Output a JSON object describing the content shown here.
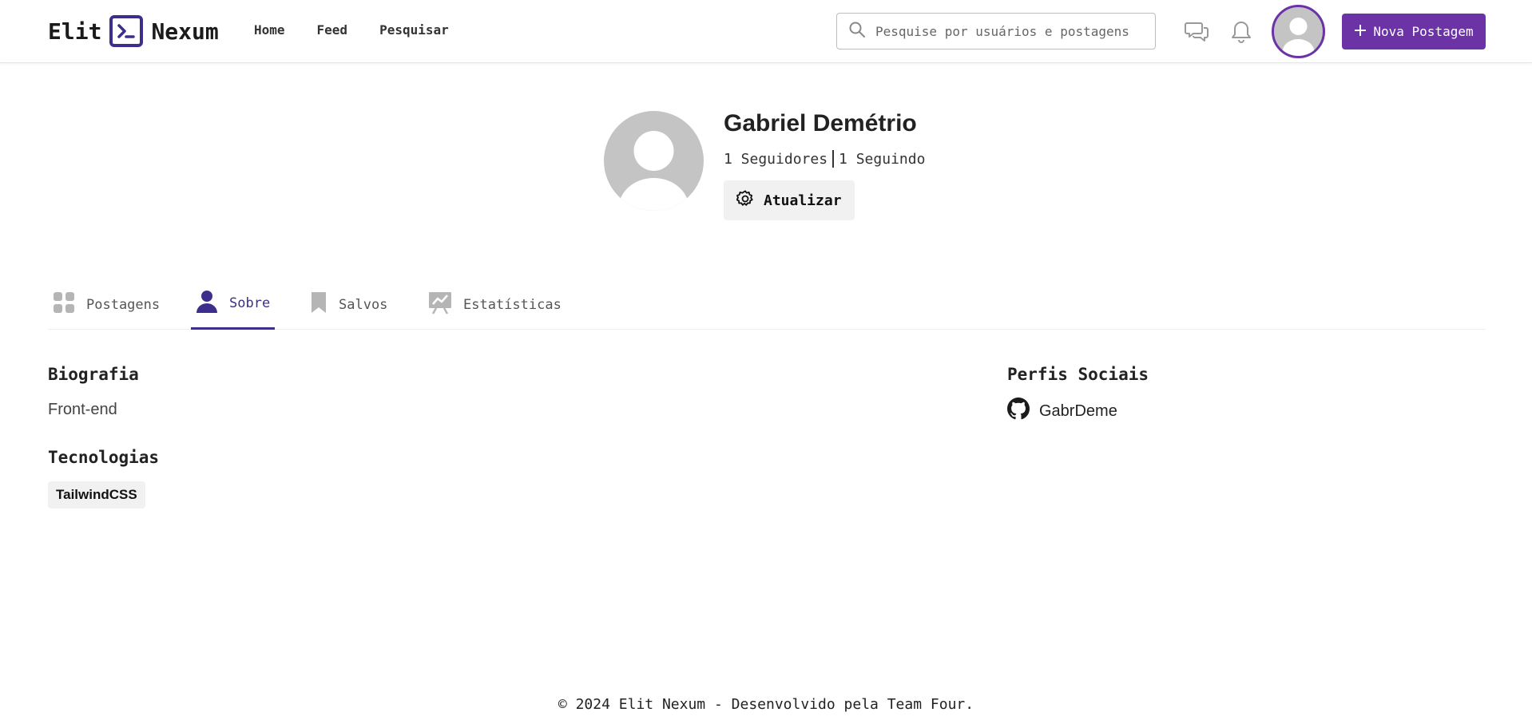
{
  "header": {
    "logo_left": "Elit",
    "logo_right": "Nexum",
    "nav": [
      "Home",
      "Feed",
      "Pesquisar"
    ],
    "search_placeholder": "Pesquise por usuários e postagens",
    "new_post_label": "Nova Postagem"
  },
  "profile": {
    "name": "Gabriel Demétrio",
    "followers": "1 Seguidores",
    "following": "1 Seguindo",
    "update_label": "Atualizar"
  },
  "tabs": [
    {
      "label": "Postagens",
      "icon": "grid-icon",
      "active": false
    },
    {
      "label": "Sobre",
      "icon": "person-icon",
      "active": true
    },
    {
      "label": "Salvos",
      "icon": "bookmark-icon",
      "active": false
    },
    {
      "label": "Estatísticas",
      "icon": "chart-icon",
      "active": false
    }
  ],
  "about": {
    "bio_title": "Biografia",
    "bio": "Front-end",
    "tech_title": "Tecnologias",
    "technologies": [
      "TailwindCSS"
    ],
    "social_title": "Perfis Sociais",
    "social": [
      {
        "icon": "github-icon",
        "handle": "GabrDeme"
      }
    ]
  },
  "footer": "© 2024 Elit Nexum - Desenvolvido pela Team Four.",
  "colors": {
    "accent": "#6b33a6",
    "brand": "#3d2e8c",
    "avatar_bg": "#c4c4c4"
  }
}
